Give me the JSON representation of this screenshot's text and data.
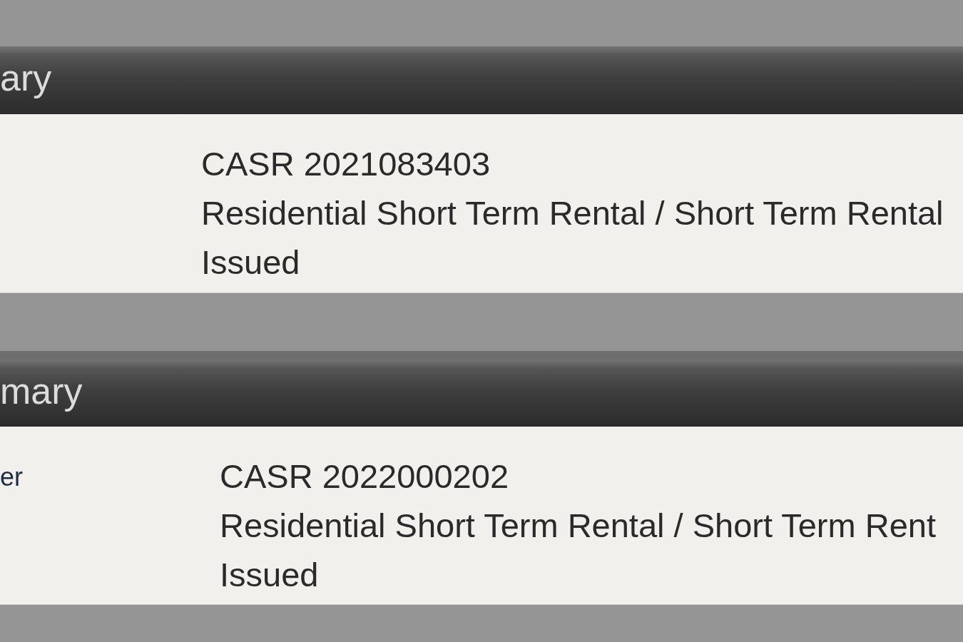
{
  "panels": [
    {
      "header": "ary",
      "fields": [
        {
          "value": "CASR 2021083403"
        },
        {
          "value": "Residential Short Term Rental / Short Term Rental"
        },
        {
          "value": "Issued"
        }
      ]
    },
    {
      "header": "mary",
      "fields": [
        {
          "label": "er",
          "value": "CASR 2022000202"
        },
        {
          "value": "Residential Short Term Rental / Short Term Rent"
        },
        {
          "value": "Issued"
        }
      ]
    }
  ]
}
